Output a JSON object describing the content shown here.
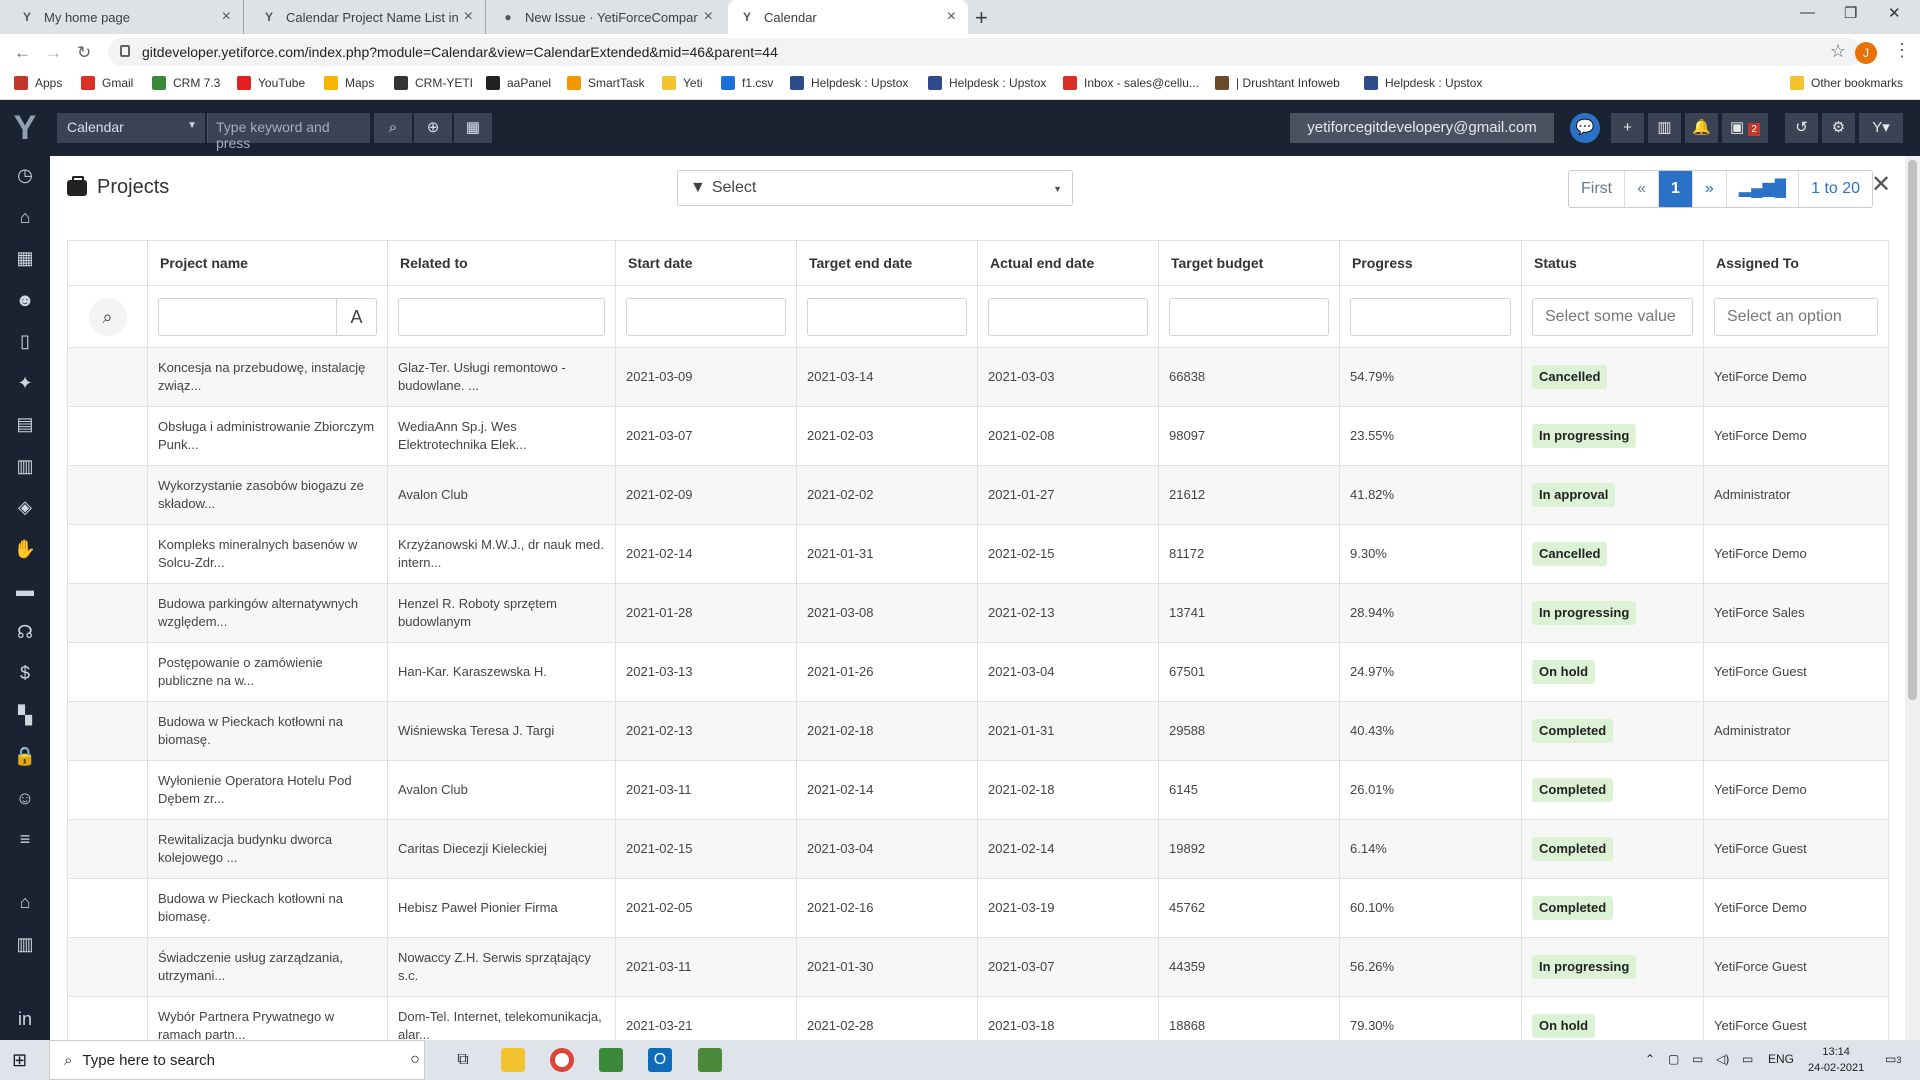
{
  "browser": {
    "tabs": [
      {
        "label": "My home page",
        "icon": "yeti-icon"
      },
      {
        "label": "Calendar Project Name List in Alp",
        "icon": "yeti-icon"
      },
      {
        "label": "New Issue · YetiForceCompany/Y",
        "icon": "github-icon"
      },
      {
        "label": "Calendar",
        "icon": "yeti-icon"
      }
    ],
    "url": "gitdeveloper.yetiforce.com/index.php?module=Calendar&view=CalendarExtended&mid=46&parent=44",
    "profile_initial": "J",
    "bookmarks": [
      {
        "label": "Apps",
        "color": "#c0392b"
      },
      {
        "label": "Gmail",
        "color": "#d93025"
      },
      {
        "label": "CRM 7.3",
        "color": "#3a8a3a"
      },
      {
        "label": "YouTube",
        "color": "#e02020"
      },
      {
        "label": "Maps",
        "color": "#f4b400"
      },
      {
        "label": "CRM-YETI",
        "color": "#333333"
      },
      {
        "label": "aaPanel",
        "color": "#222222"
      },
      {
        "label": "SmartTask",
        "color": "#f29900"
      },
      {
        "label": "Yeti",
        "color": "#f4c430"
      },
      {
        "label": "f1.csv",
        "color": "#1e6fd9"
      },
      {
        "label": "Helpdesk : Upstox",
        "color": "#2d4a8a"
      },
      {
        "label": "Helpdesk : Upstox",
        "color": "#2d4a8a"
      },
      {
        "label": "Inbox - sales@cellu...",
        "color": "#d93025"
      },
      {
        "label": "| Drushtant Infoweb",
        "color": "#6a4b2b"
      },
      {
        "label": "Helpdesk : Upstox",
        "color": "#2d4a8a"
      }
    ],
    "other_bookmarks": "Other bookmarks"
  },
  "app": {
    "module": "Calendar",
    "search_placeholder": "Type keyword and press",
    "email": "yetiforcegitdevelopery@gmail.com",
    "notification_count": "2"
  },
  "modal": {
    "title": "Projects",
    "filter_label": "Select",
    "pager": {
      "first": "First",
      "prev": "«",
      "current": "1",
      "next": "»",
      "range": "1 to 20"
    },
    "columns": [
      "Project name",
      "Related to",
      "Start date",
      "Target end date",
      "Actual end date",
      "Target budget",
      "Progress",
      "Status",
      "Assigned To"
    ],
    "filters": {
      "text_toggle": "A",
      "status_placeholder": "Select some value",
      "assigned_placeholder": "Select an option"
    },
    "rows": [
      {
        "name": "Koncesja na przebudowę, instalację związ...",
        "related": "Glaz-Ter. Usługi remontowo - budowlane. ...",
        "start": "2021-03-09",
        "target_end": "2021-03-14",
        "actual_end": "2021-03-03",
        "budget": "66838",
        "progress": "54.79%",
        "status": "Cancelled",
        "assigned": "YetiForce Demo"
      },
      {
        "name": "Obsługa i administrowanie Zbiorczym Punk...",
        "related": "WediaAnn Sp.j. Wes Elektrotechnika Elek...",
        "start": "2021-03-07",
        "target_end": "2021-02-03",
        "actual_end": "2021-02-08",
        "budget": "98097",
        "progress": "23.55%",
        "status": "In progressing",
        "assigned": "YetiForce Demo"
      },
      {
        "name": "Wykorzystanie zasobów biogazu ze składow...",
        "related": "Avalon Club",
        "start": "2021-02-09",
        "target_end": "2021-02-02",
        "actual_end": "2021-01-27",
        "budget": "21612",
        "progress": "41.82%",
        "status": "In approval",
        "assigned": "Administrator"
      },
      {
        "name": "Kompleks mineralnych basenów w Solcu-Zdr...",
        "related": "Krzyżanowski M.W.J., dr nauk med. intern...",
        "start": "2021-02-14",
        "target_end": "2021-01-31",
        "actual_end": "2021-02-15",
        "budget": "81172",
        "progress": "9.30%",
        "status": "Cancelled",
        "assigned": "YetiForce Demo"
      },
      {
        "name": "Budowa parkingów alternatywnych względem...",
        "related": "Henzel R. Roboty sprzętem budowlanym",
        "start": "2021-01-28",
        "target_end": "2021-03-08",
        "actual_end": "2021-02-13",
        "budget": "13741",
        "progress": "28.94%",
        "status": "In progressing",
        "assigned": "YetiForce Sales"
      },
      {
        "name": "Postępowanie o zamówienie publiczne na w...",
        "related": "Han-Kar. Karaszewska H.",
        "start": "2021-03-13",
        "target_end": "2021-01-26",
        "actual_end": "2021-03-04",
        "budget": "67501",
        "progress": "24.97%",
        "status": "On hold",
        "assigned": "YetiForce Guest"
      },
      {
        "name": "Budowa w Pieckach kotłowni na biomasę.",
        "related": "Wiśniewska Teresa J. Targi",
        "start": "2021-02-13",
        "target_end": "2021-02-18",
        "actual_end": "2021-01-31",
        "budget": "29588",
        "progress": "40.43%",
        "status": "Completed",
        "assigned": "Administrator"
      },
      {
        "name": "Wyłonienie Operatora Hotelu Pod Dębem zr...",
        "related": "Avalon Club",
        "start": "2021-03-11",
        "target_end": "2021-02-14",
        "actual_end": "2021-02-18",
        "budget": "6145",
        "progress": "26.01%",
        "status": "Completed",
        "assigned": "YetiForce Demo"
      },
      {
        "name": "Rewitalizacja budynku dworca kolejowego ...",
        "related": "Caritas Diecezji Kieleckiej",
        "start": "2021-02-15",
        "target_end": "2021-03-04",
        "actual_end": "2021-02-14",
        "budget": "19892",
        "progress": "6.14%",
        "status": "Completed",
        "assigned": "YetiForce Guest"
      },
      {
        "name": "Budowa w Pieckach kotłowni na biomasę.",
        "related": "Hebisz Paweł Pionier Firma",
        "start": "2021-02-05",
        "target_end": "2021-02-16",
        "actual_end": "2021-03-19",
        "budget": "45762",
        "progress": "60.10%",
        "status": "Completed",
        "assigned": "YetiForce Demo"
      },
      {
        "name": "Świadczenie usług zarządzania, utrzymani...",
        "related": "Nowaccy Z.H. Serwis sprzątający s.c.",
        "start": "2021-03-11",
        "target_end": "2021-01-30",
        "actual_end": "2021-03-07",
        "budget": "44359",
        "progress": "56.26%",
        "status": "In progressing",
        "assigned": "YetiForce Guest"
      },
      {
        "name": "Wybór Partnera Prywatnego w ramach partn...",
        "related": "Dom-Tel. Internet, telekomunikacja, alar...",
        "start": "2021-03-21",
        "target_end": "2021-02-28",
        "actual_end": "2021-03-18",
        "budget": "18868",
        "progress": "79.30%",
        "status": "On hold",
        "assigned": "YetiForce Guest"
      }
    ]
  },
  "taskbar": {
    "search_placeholder": "Type here to search",
    "language": "ENG",
    "time": "13:14",
    "date": "24-02-2021",
    "notif_count": "3"
  }
}
